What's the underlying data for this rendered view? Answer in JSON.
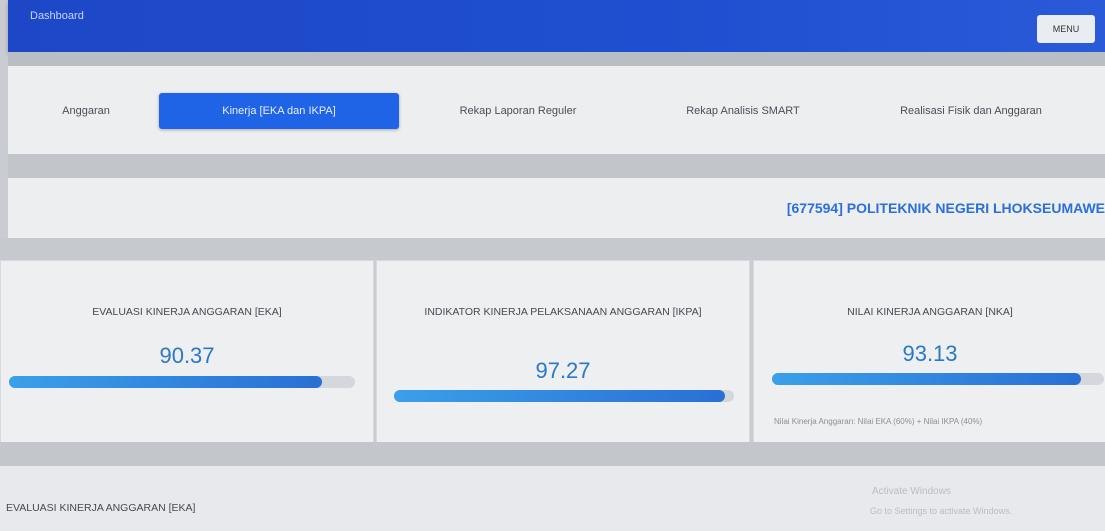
{
  "header": {
    "title": "Dashboard",
    "menu_label": "MENU"
  },
  "tabs": [
    {
      "label": "Anggaran",
      "active": false
    },
    {
      "label": "Kinerja [EKA dan IKPA]",
      "active": true
    },
    {
      "label": "Rekap Laporan Reguler",
      "active": false
    },
    {
      "label": "Rekap Analisis SMART",
      "active": false
    },
    {
      "label": "Realisasi Fisik dan Anggaran",
      "active": false
    }
  ],
  "organization": "[677594] POLITEKNIK NEGERI LHOKSEUMAWE",
  "cards": [
    {
      "title": "EVALUASI KINERJA ANGGARAN [EKA]",
      "value": "90.37",
      "percent": 90.37
    },
    {
      "title": "INDIKATOR KINERJA PELAKSANAAN ANGGARAN [IKPA]",
      "value": "97.27",
      "percent": 97.27
    },
    {
      "title": "NILAI KINERJA ANGGARAN [NKA]",
      "value": "93.13",
      "percent": 93.13,
      "note": "Nilai Kinerja Anggaran: Nilai EKA (60%) + Nilai IKPA (40%)"
    }
  ],
  "section_title": "EVALUASI KINERJA ANGGARAN [EKA]",
  "watermark": {
    "line1": "Activate Windows",
    "line2": "Go to Settings to activate Windows."
  },
  "colors": {
    "primary": "#1f4fd0",
    "active_tab": "#1f63e6",
    "value_text": "#2a78c6"
  }
}
